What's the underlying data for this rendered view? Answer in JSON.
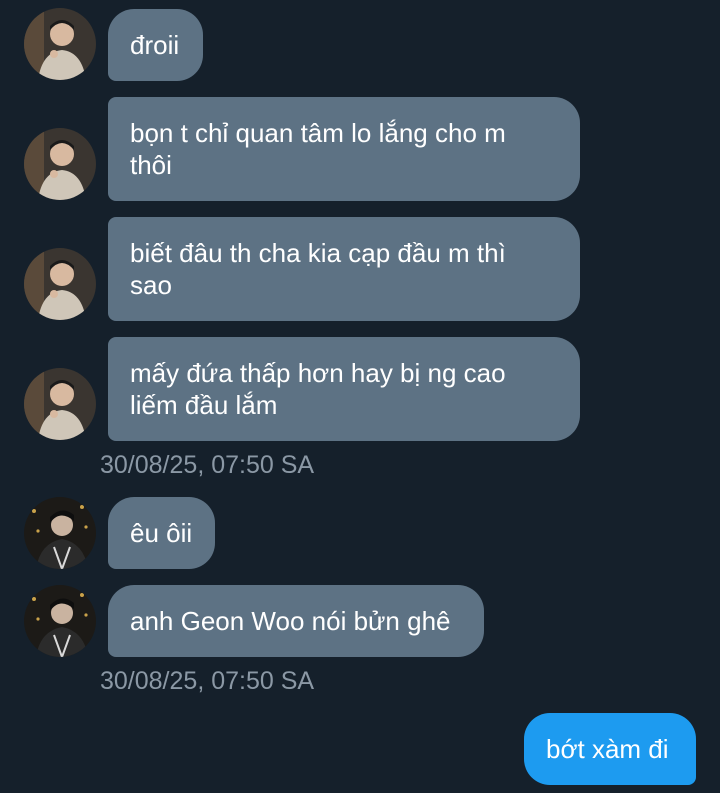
{
  "conversation": {
    "group_a": {
      "avatar_icon": "person-avatar-beige-jacket",
      "messages": [
        {
          "text": "đroii"
        },
        {
          "text": "bọn t chỉ quan tâm lo lắng cho m\nthôi"
        },
        {
          "text": "biết đâu th cha kia cạp đầu m thì\nsao"
        },
        {
          "text": "mấy đứa thấp hơn hay bị ng cao\nliếm đầu lắm"
        }
      ],
      "timestamp": "30/08/25, 07:50 SA"
    },
    "group_b": {
      "avatar_icon": "person-avatar-dark-jacket",
      "messages": [
        {
          "text": "êu ôii"
        },
        {
          "text": "anh Geon Woo nói bửn ghê"
        }
      ],
      "timestamp": "30/08/25, 07:50 SA"
    },
    "outgoing": {
      "messages": [
        {
          "text": "bớt xàm đi"
        }
      ]
    }
  },
  "colors": {
    "background": "#15202b",
    "incoming_bubble": "#5d7284",
    "outgoing_bubble": "#1d9bf0",
    "timestamp": "#8b98a5"
  }
}
